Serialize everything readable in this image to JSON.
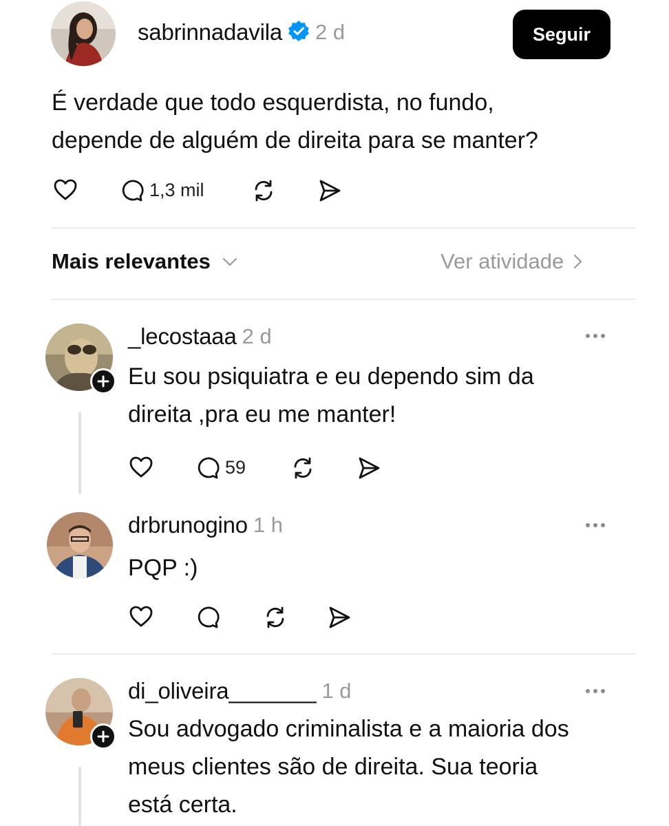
{
  "post": {
    "username": "sabrinnadavila",
    "time": "2 d",
    "follow_label": "Seguir",
    "text_line1": "É verdade que todo esquerdista, no fundo,",
    "text_line2": "depende de alguém de direita para se manter?",
    "reply_count": "1,3 mil"
  },
  "sort": {
    "label": "Mais relevantes",
    "activity_label": "Ver atividade"
  },
  "comments": [
    {
      "username": "_lecostaaa",
      "time": "2 d",
      "line1": "Eu sou psiquiatra e eu dependo sim da",
      "line2": "direita ,pra eu me manter!",
      "reply_count": "59"
    },
    {
      "username": "drbrunogino",
      "time": "1 h",
      "line1": "PQP :)"
    },
    {
      "username": "di_oliveira_______",
      "time": "1 d",
      "line1": "Sou advogado criminalista e a maioria dos",
      "line2": "meus clientes são de direita. Sua teoria",
      "line3": "está certa."
    }
  ],
  "colors": {
    "verified": "#0095f6",
    "follow_button_bg": "#000000",
    "muted_text": "#9a9a9a"
  },
  "icons": [
    "heart-icon",
    "comment-icon",
    "repost-icon",
    "share-icon",
    "verified-badge-icon",
    "chevron-down-icon",
    "chevron-right-icon",
    "more-icon",
    "plus-icon"
  ]
}
